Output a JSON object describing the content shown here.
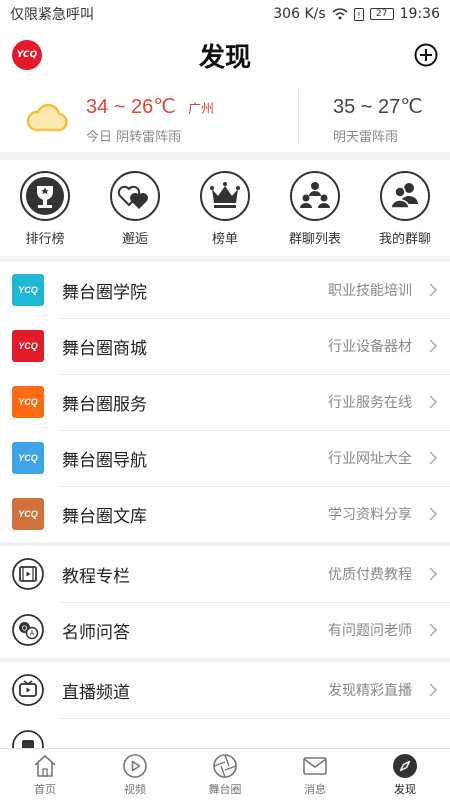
{
  "status_bar": {
    "carrier": "仅限紧急呼叫",
    "speed": "306 K/s",
    "battery": "27",
    "time": "19:36"
  },
  "header": {
    "logo_text": "YCQ",
    "title": "发现"
  },
  "weather": {
    "today": {
      "temp": "34 ~ 26℃",
      "city": "广州",
      "desc": "今日 阴转雷阵雨"
    },
    "tomorrow": {
      "temp": "35 ~ 27℃",
      "desc": "明天雷阵雨"
    }
  },
  "quick": [
    {
      "label": "排行榜",
      "icon": "trophy-icon"
    },
    {
      "label": "邂逅",
      "icon": "hearts-icon"
    },
    {
      "label": "榜单",
      "icon": "crown-icon"
    },
    {
      "label": "群聊列表",
      "icon": "group-icon"
    },
    {
      "label": "我的群聊",
      "icon": "users-icon"
    }
  ],
  "group1": [
    {
      "title": "舞台圈学院",
      "sub": "职业技能培训",
      "color": "#1fb8d2",
      "badge": "YCQ"
    },
    {
      "title": "舞台圈商城",
      "sub": "行业设备器材",
      "color": "#e21b2a",
      "badge": "YCQ"
    },
    {
      "title": "舞台圈服务",
      "sub": "行业服务在线",
      "color": "#ff6a13",
      "badge": "YCQ"
    },
    {
      "title": "舞台圈导航",
      "sub": "行业网址大全",
      "color": "#3fa3e8",
      "badge": "YCQ"
    },
    {
      "title": "舞台圈文库",
      "sub": "学习资料分享",
      "color": "#d0713b",
      "badge": "YCQ"
    }
  ],
  "group2": [
    {
      "title": "教程专栏",
      "sub": "优质付费教程",
      "icon": "film-icon"
    },
    {
      "title": "名师问答",
      "sub": "有问题问老师",
      "icon": "qa-icon"
    }
  ],
  "group3": [
    {
      "title": "直播频道",
      "sub": "发现精彩直播",
      "icon": "tv-icon"
    },
    {
      "title": "",
      "sub": "",
      "icon": "info-icon"
    }
  ],
  "tabs": [
    {
      "label": "首页",
      "icon": "home-icon"
    },
    {
      "label": "视频",
      "icon": "play-icon"
    },
    {
      "label": "舞台圈",
      "icon": "aperture-icon"
    },
    {
      "label": "消息",
      "icon": "mail-icon"
    },
    {
      "label": "发现",
      "icon": "compass-icon",
      "active": true
    }
  ]
}
